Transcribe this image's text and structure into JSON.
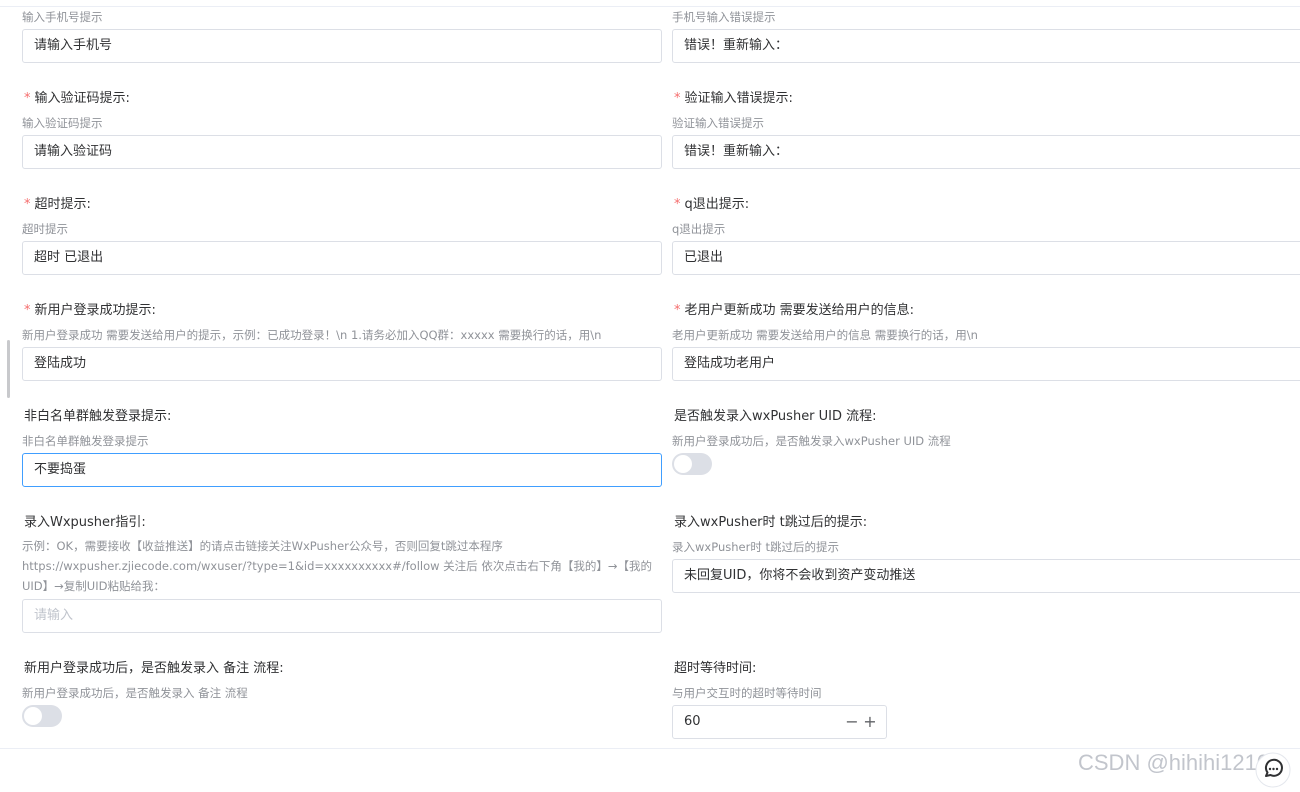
{
  "rows": [
    {
      "left": {
        "hint": "输入手机号提示",
        "value": "请输入手机号"
      },
      "right": {
        "hint": "手机号输入错误提示",
        "value": "错误！重新输入："
      }
    },
    {
      "left": {
        "label": "输入验证码提示:",
        "required": true,
        "hint": "输入验证码提示",
        "value": "请输入验证码"
      },
      "right": {
        "label": "验证输入错误提示:",
        "required": true,
        "hint": "验证输入错误提示",
        "value": "错误！重新输入："
      }
    },
    {
      "left": {
        "label": "超时提示:",
        "required": true,
        "hint": "超时提示",
        "value": "超时 已退出"
      },
      "right": {
        "label": "q退出提示:",
        "required": true,
        "hint": "q退出提示",
        "value": "已退出"
      }
    },
    {
      "left": {
        "label": "新用户登录成功提示:",
        "required": true,
        "hint": "新用户登录成功 需要发送给用户的提示，示例：已成功登录！\\n 1.请务必加入QQ群：xxxxx 需要换行的话，用\\n",
        "value": "登陆成功"
      },
      "right": {
        "label": "老用户更新成功 需要发送给用户的信息:",
        "required": true,
        "hint": "老用户更新成功 需要发送给用户的信息 需要换行的话，用\\n",
        "value": "登陆成功老用户"
      }
    },
    {
      "left": {
        "label": "非白名单群触发登录提示:",
        "hint": "非白名单群触发登录提示",
        "value": "不要捣蛋"
      },
      "right": {
        "label": "是否触发录入wxPusher UID 流程:",
        "hint": "新用户登录成功后，是否触发录入wxPusher UID 流程",
        "toggle": false
      }
    },
    {
      "left": {
        "label": "录入Wxpusher指引:",
        "hint_lines": [
          "示例：OK，需要接收【收益推送】的请点击链接关注WxPusher公众号，否则回复t跳过本程序",
          "https://wxpusher.zjiecode.com/wxuser/?type=1&id=xxxxxxxxxx#/follow 关注后 依次点击右下角【我的】→【我的",
          "UID】→复制UID粘贴给我："
        ],
        "placeholder": "请输入"
      },
      "right": {
        "label": "录入wxPusher时 t跳过后的提示:",
        "hint": "录入wxPusher时 t跳过后的提示",
        "value": "未回复UID，你将不会收到资产变动推送"
      }
    },
    {
      "left": {
        "label": "新用户登录成功后，是否触发录入 备注 流程:",
        "hint": "新用户登录成功后，是否触发录入 备注 流程",
        "toggle": false
      },
      "right": {
        "label": "超时等待时间:",
        "hint": "与用户交互时的超时等待时间",
        "value": "60",
        "minus": "−",
        "plus": "+"
      }
    }
  ],
  "watermark": "CSDN @hihihi1210",
  "icons": {
    "chat": "chat-bubble-icon"
  },
  "colors": {
    "required": "#f56c6c",
    "focus": "#409eff",
    "border": "#dcdfe6",
    "hint": "#909399"
  }
}
